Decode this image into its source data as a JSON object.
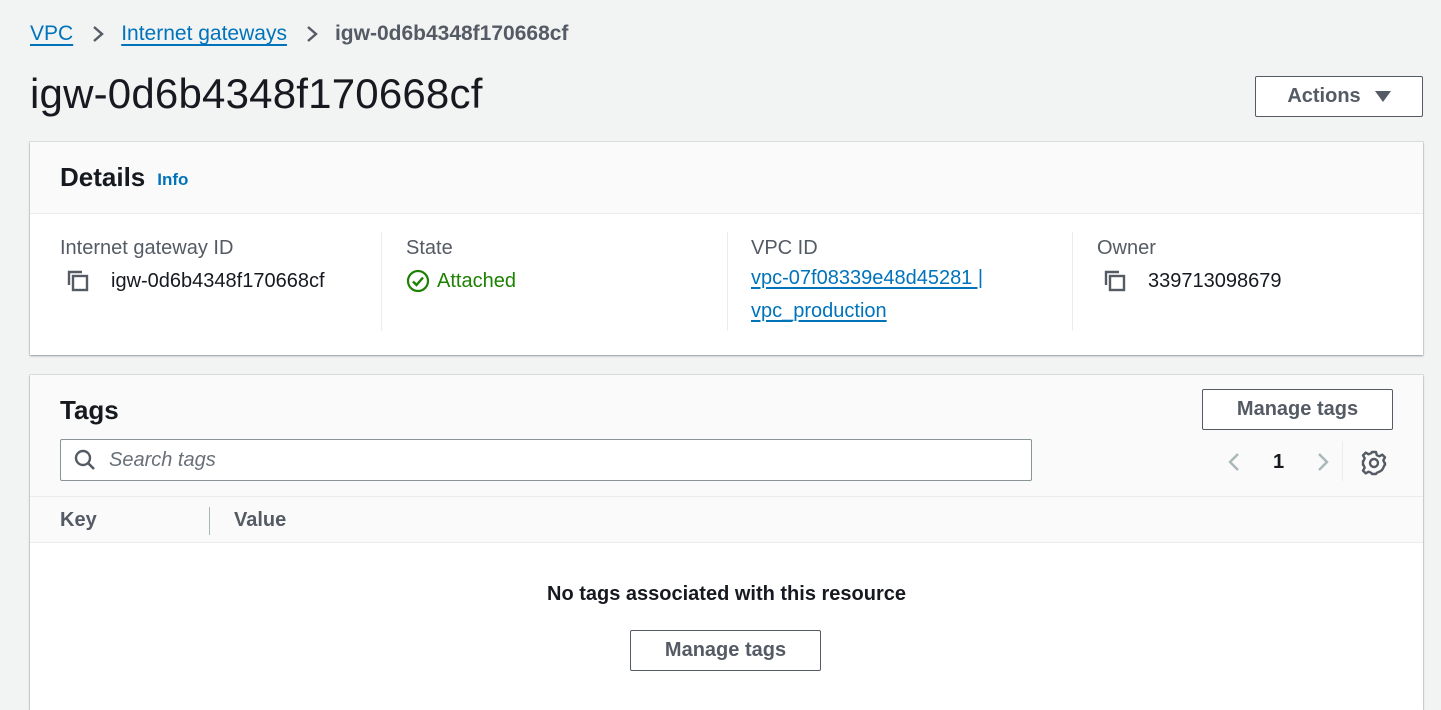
{
  "breadcrumb": {
    "items": [
      {
        "label": "VPC"
      },
      {
        "label": "Internet gateways"
      }
    ],
    "current": "igw-0d6b4348f170668cf"
  },
  "page": {
    "title": "igw-0d6b4348f170668cf",
    "actions_label": "Actions"
  },
  "details": {
    "title": "Details",
    "info_label": "Info",
    "fields": {
      "gateway_id": {
        "label": "Internet gateway ID",
        "value": "igw-0d6b4348f170668cf"
      },
      "state": {
        "label": "State",
        "value": "Attached"
      },
      "vpc": {
        "label": "VPC ID",
        "line1": "vpc-07f08339e48d45281 |",
        "line2": "vpc_production"
      },
      "owner": {
        "label": "Owner",
        "value": "339713098679"
      }
    }
  },
  "tags": {
    "title": "Tags",
    "manage_label": "Manage tags",
    "search_placeholder": "Search tags",
    "page_number": "1",
    "columns": [
      "Key",
      "Value"
    ],
    "empty_message": "No tags associated with this resource",
    "empty_manage_label": "Manage tags"
  },
  "colors": {
    "link": "#0073bb",
    "success": "#1d8102",
    "text_secondary": "#545b64",
    "background": "#f2f3f3"
  },
  "icons": [
    "chevron-right-icon",
    "caret-down-icon",
    "copy-icon",
    "status-success-icon",
    "search-icon",
    "chevron-left-icon",
    "settings-gear-icon"
  ]
}
